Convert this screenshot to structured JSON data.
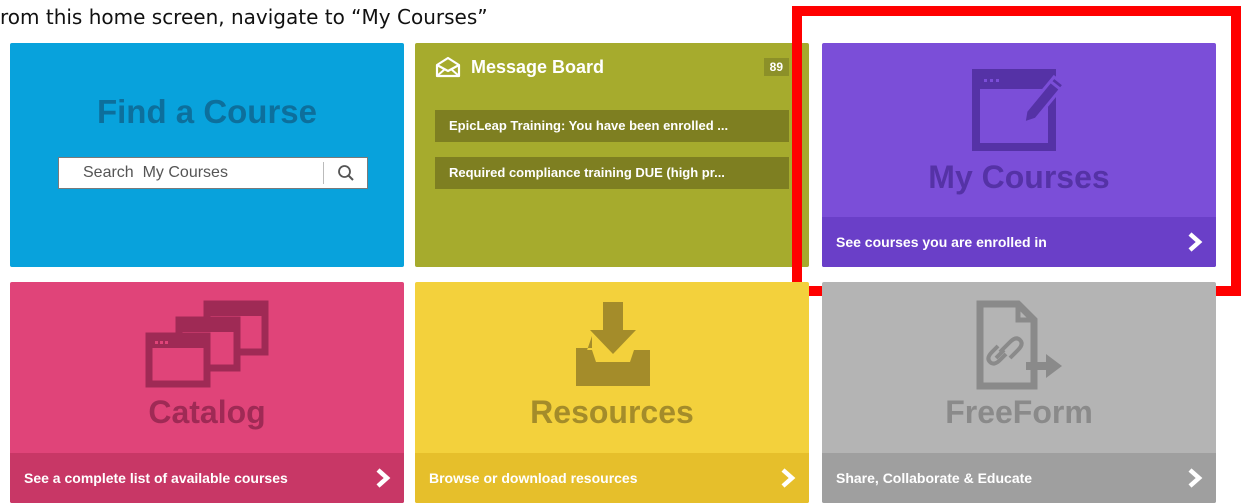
{
  "instruction": "rom this home screen, navigate to “My Courses”",
  "find_course": {
    "title": "Find a Course",
    "search_placeholder": "Search  My Courses"
  },
  "message_board": {
    "title": "Message Board",
    "count": "89",
    "items": [
      "EpicLeap Training: You have been enrolled ...",
      "Required compliance training DUE (high pr..."
    ]
  },
  "my_courses": {
    "title": "My Courses",
    "footer": "See courses you are enrolled in"
  },
  "catalog": {
    "title": "Catalog",
    "footer": "See a complete list of available courses"
  },
  "resources": {
    "title": "Resources",
    "footer": "Browse or download resources"
  },
  "freeform": {
    "title": "FreeForm",
    "footer": "Share, Collaborate & Educate"
  },
  "icons": {
    "search": "search-icon",
    "message": "envelope-icon",
    "courses": "window-pencil-icon",
    "catalog": "stacked-windows-icon",
    "resources": "download-tray-icon",
    "freeform": "document-link-icon",
    "chevron": "chevron-right-icon"
  },
  "colors": {
    "find_course": "#08a2dc",
    "message_board": "#a6ab2d",
    "my_courses": "#7b4ed8",
    "catalog": "#e04479",
    "resources": "#f3d13c",
    "freeform": "#b4b4b4",
    "highlight": "#ff0000"
  }
}
